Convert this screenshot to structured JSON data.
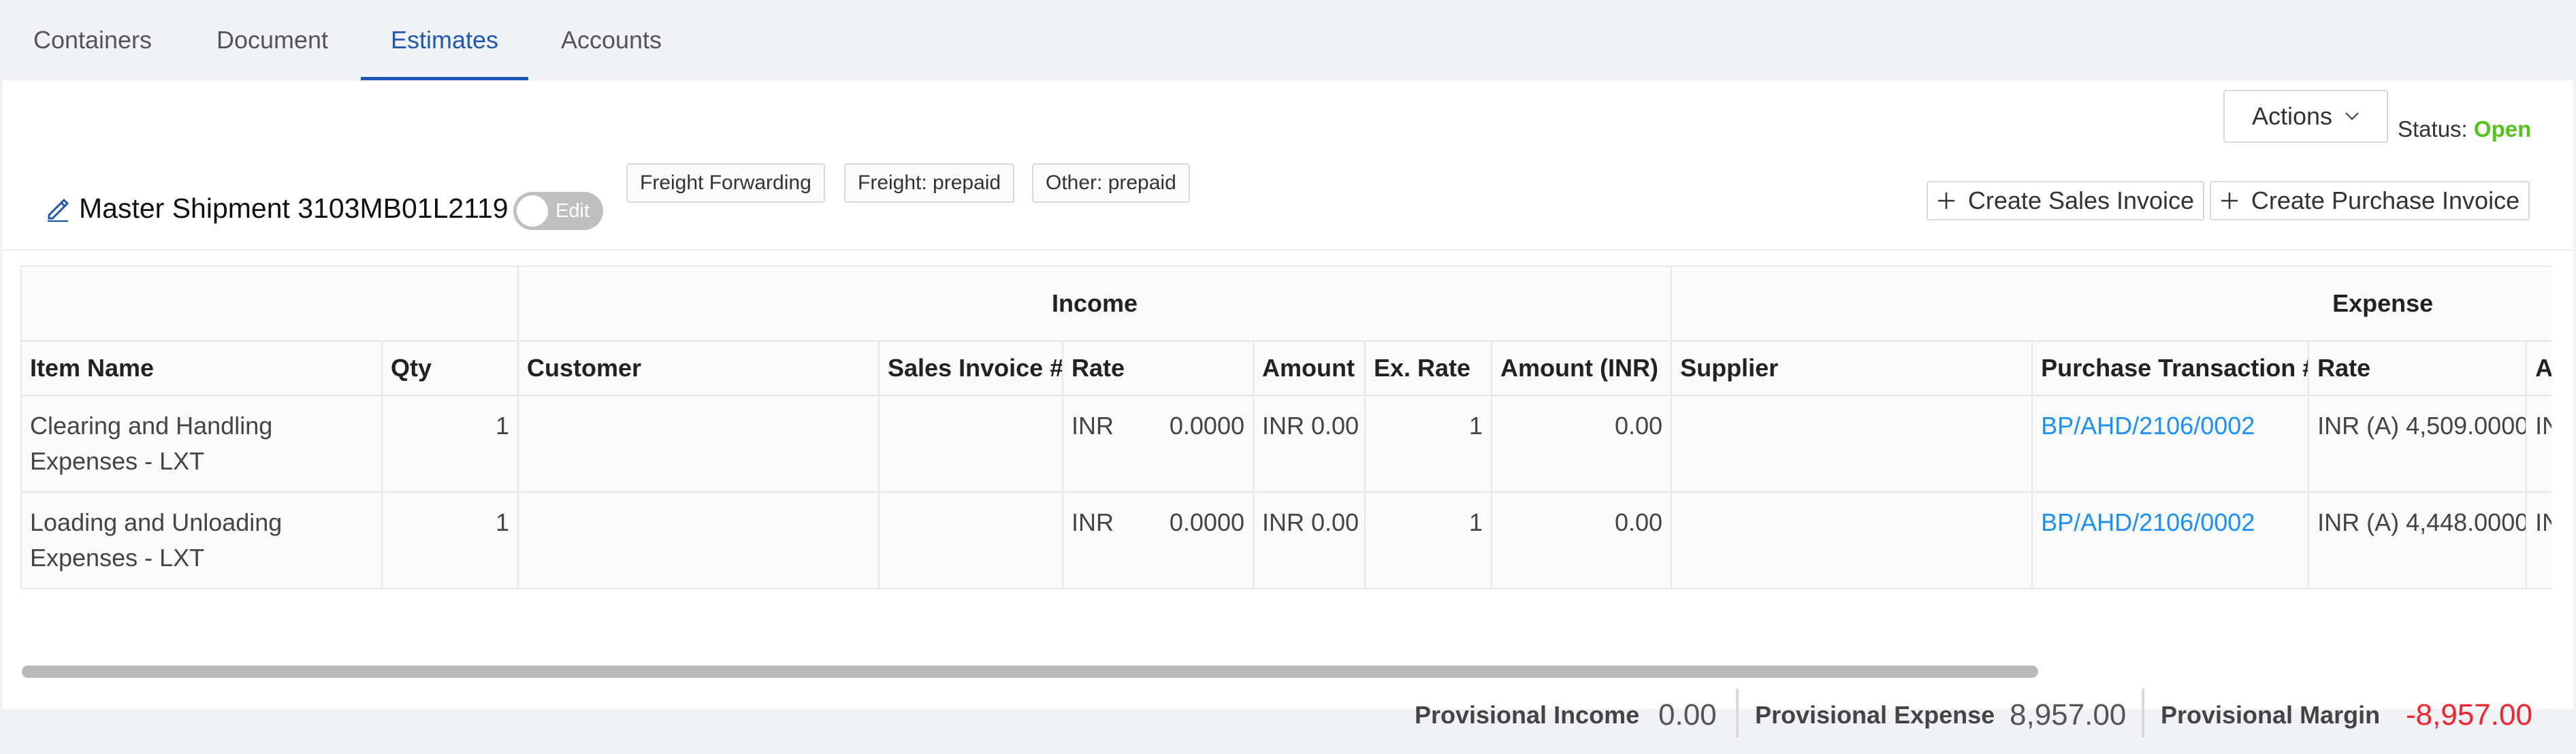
{
  "tabs": [
    {
      "label": "Containers"
    },
    {
      "label": "Document"
    },
    {
      "label": "Estimates",
      "active": true
    },
    {
      "label": "Accounts"
    }
  ],
  "actions": {
    "label": "Actions"
  },
  "status": {
    "label": "Status:",
    "value": "Open",
    "value_color": "#52c41a"
  },
  "shipment": {
    "title": "Master Shipment 3103MB01L2119",
    "edit_toggle": "Edit",
    "tags": [
      "Freight Forwarding",
      "Freight: prepaid",
      "Other: prepaid"
    ]
  },
  "buttons": {
    "create_sales": "Create Sales Invoice",
    "create_purchase": "Create Purchase Invoice"
  },
  "table": {
    "groups": {
      "income": "Income",
      "expense": "Expense"
    },
    "columns": [
      "Item Name",
      "Qty",
      "Customer",
      "Sales Invoice #",
      "Rate",
      "Amount",
      "Ex. Rate",
      "Amount (INR)",
      "Supplier",
      "Purchase Transaction #",
      "Rate",
      "A"
    ],
    "rows": [
      {
        "item": "Clearing and Handling Expenses - LXT",
        "qty": "1",
        "customer": "",
        "sales_invoice": "",
        "rate_cur": "INR",
        "rate_val": "0.0000",
        "amount": "INR 0.00",
        "ex_rate": "1",
        "amount_inr": "0.00",
        "supplier": "",
        "purchase_txn": "BP/AHD/2106/0002",
        "exp_rate": "INR (A) 4,509.0000",
        "exp_amount_trunc": "IN"
      },
      {
        "item": "Loading and Unloading Expenses - LXT",
        "qty": "1",
        "customer": "",
        "sales_invoice": "",
        "rate_cur": "INR",
        "rate_val": "0.0000",
        "amount": "INR 0.00",
        "ex_rate": "1",
        "amount_inr": "0.00",
        "supplier": "",
        "purchase_txn": "BP/AHD/2106/0002",
        "exp_rate": "INR (A) 4,448.0000",
        "exp_amount_trunc": "IN"
      }
    ]
  },
  "totals": {
    "income_label": "Provisional Income",
    "income_value": "0.00",
    "expense_label": "Provisional Expense",
    "expense_value": "8,957.00",
    "margin_label": "Provisional Margin",
    "margin_value": "-8,957.00",
    "margin_color": "#f5222d"
  }
}
